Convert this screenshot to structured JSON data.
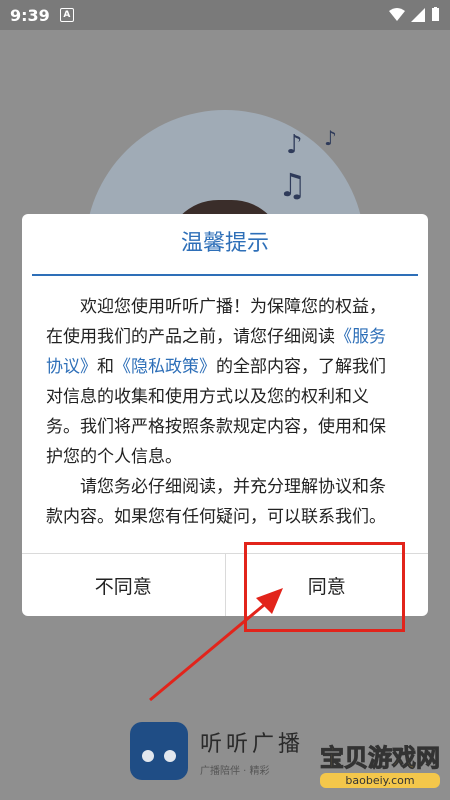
{
  "status": {
    "time": "9:39",
    "notif_letter": "A"
  },
  "dialog": {
    "title": "温馨提示",
    "p1_a": "欢迎您使用听听广播！为保障您的权益，在使用我们的产品之前，请您仔细阅读",
    "p1_link1": "《服务协议》",
    "p1_b": "和",
    "p1_link2": "《隐私政策》",
    "p1_c": "的全部内容，了解我们对信息的收集和使用方式以及您的权利和义务。我们将严格按照条款规定内容，使用和保护您的个人信息。",
    "p2": "请您务必仔细阅读，并充分理解协议和条款内容。如果您有任何疑问，可以联系我们。",
    "btn_decline": "不同意",
    "btn_agree": "同意"
  },
  "background": {
    "app_name": "听听广播",
    "slogan": "广播陪伴 · 精彩"
  },
  "watermark": {
    "big": "宝贝游戏网",
    "small": "baobeiy.com"
  },
  "colors": {
    "accent": "#2e6fb8",
    "highlight": "#e2241b"
  }
}
